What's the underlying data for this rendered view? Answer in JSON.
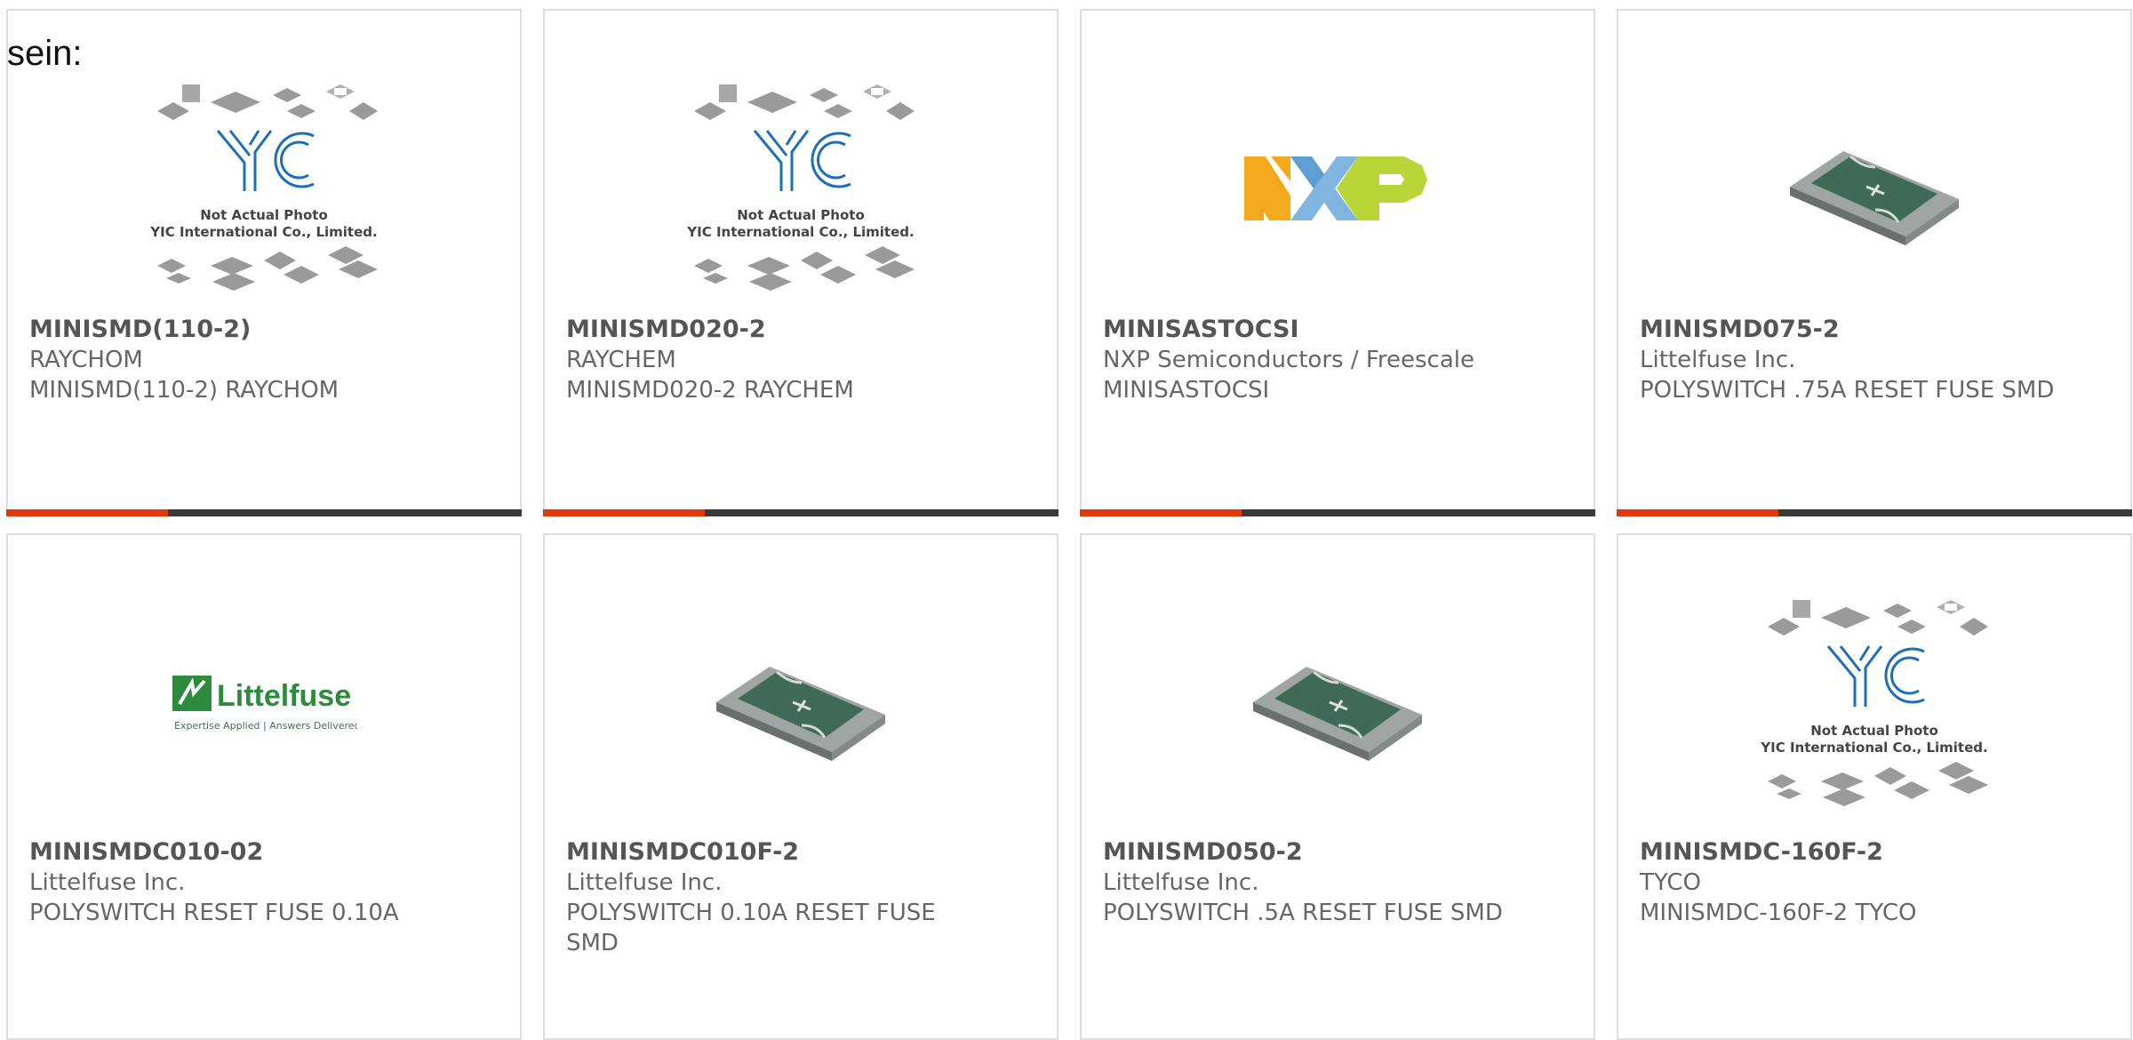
{
  "intro_text": "sein:",
  "colors": {
    "accent_bar": "#e23a0d",
    "bar_dark": "#3a3a3a",
    "card_border": "#dedede"
  },
  "placeholder_caption": {
    "line1": "Not Actual Photo",
    "line2": "YIC International Co., Limited."
  },
  "logos": {
    "yic": "YIC",
    "nxp": "NXP",
    "littelfuse_name": "Littelfuse",
    "littelfuse_tagline": "Expertise Applied | Answers Delivered"
  },
  "products": [
    {
      "part": "MINISMD(110-2)",
      "manufacturer": "RAYCHOM",
      "description": "MINISMD(110-2) RAYCHOM",
      "image": "yic-placeholder"
    },
    {
      "part": "MINISMD020-2",
      "manufacturer": "RAYCHEM",
      "description": "MINISMD020-2 RAYCHEM",
      "image": "yic-placeholder"
    },
    {
      "part": "MINISASTOCSI",
      "manufacturer": "NXP Semiconductors / Freescale",
      "description": "MINISASTOCSI",
      "image": "nxp-logo"
    },
    {
      "part": "MINISMD075-2",
      "manufacturer": "Littelfuse Inc.",
      "description": "POLYSWITCH .75A RESET FUSE SMD",
      "image": "smd-fuse-photo"
    },
    {
      "part": "MINISMDC010-02",
      "manufacturer": "Littelfuse Inc.",
      "description": "POLYSWITCH RESET FUSE 0.10A",
      "image": "littelfuse-logo"
    },
    {
      "part": "MINISMDC010F-2",
      "manufacturer": "Littelfuse Inc.",
      "description": "POLYSWITCH 0.10A RESET FUSE SMD",
      "image": "smd-fuse-photo"
    },
    {
      "part": "MINISMD050-2",
      "manufacturer": "Littelfuse Inc.",
      "description": "POLYSWITCH .5A RESET FUSE SMD",
      "image": "smd-fuse-photo"
    },
    {
      "part": "MINISMDC-160F-2",
      "manufacturer": "TYCO",
      "description": "MINISMDC-160F-2 TYCO",
      "image": "yic-placeholder"
    }
  ]
}
